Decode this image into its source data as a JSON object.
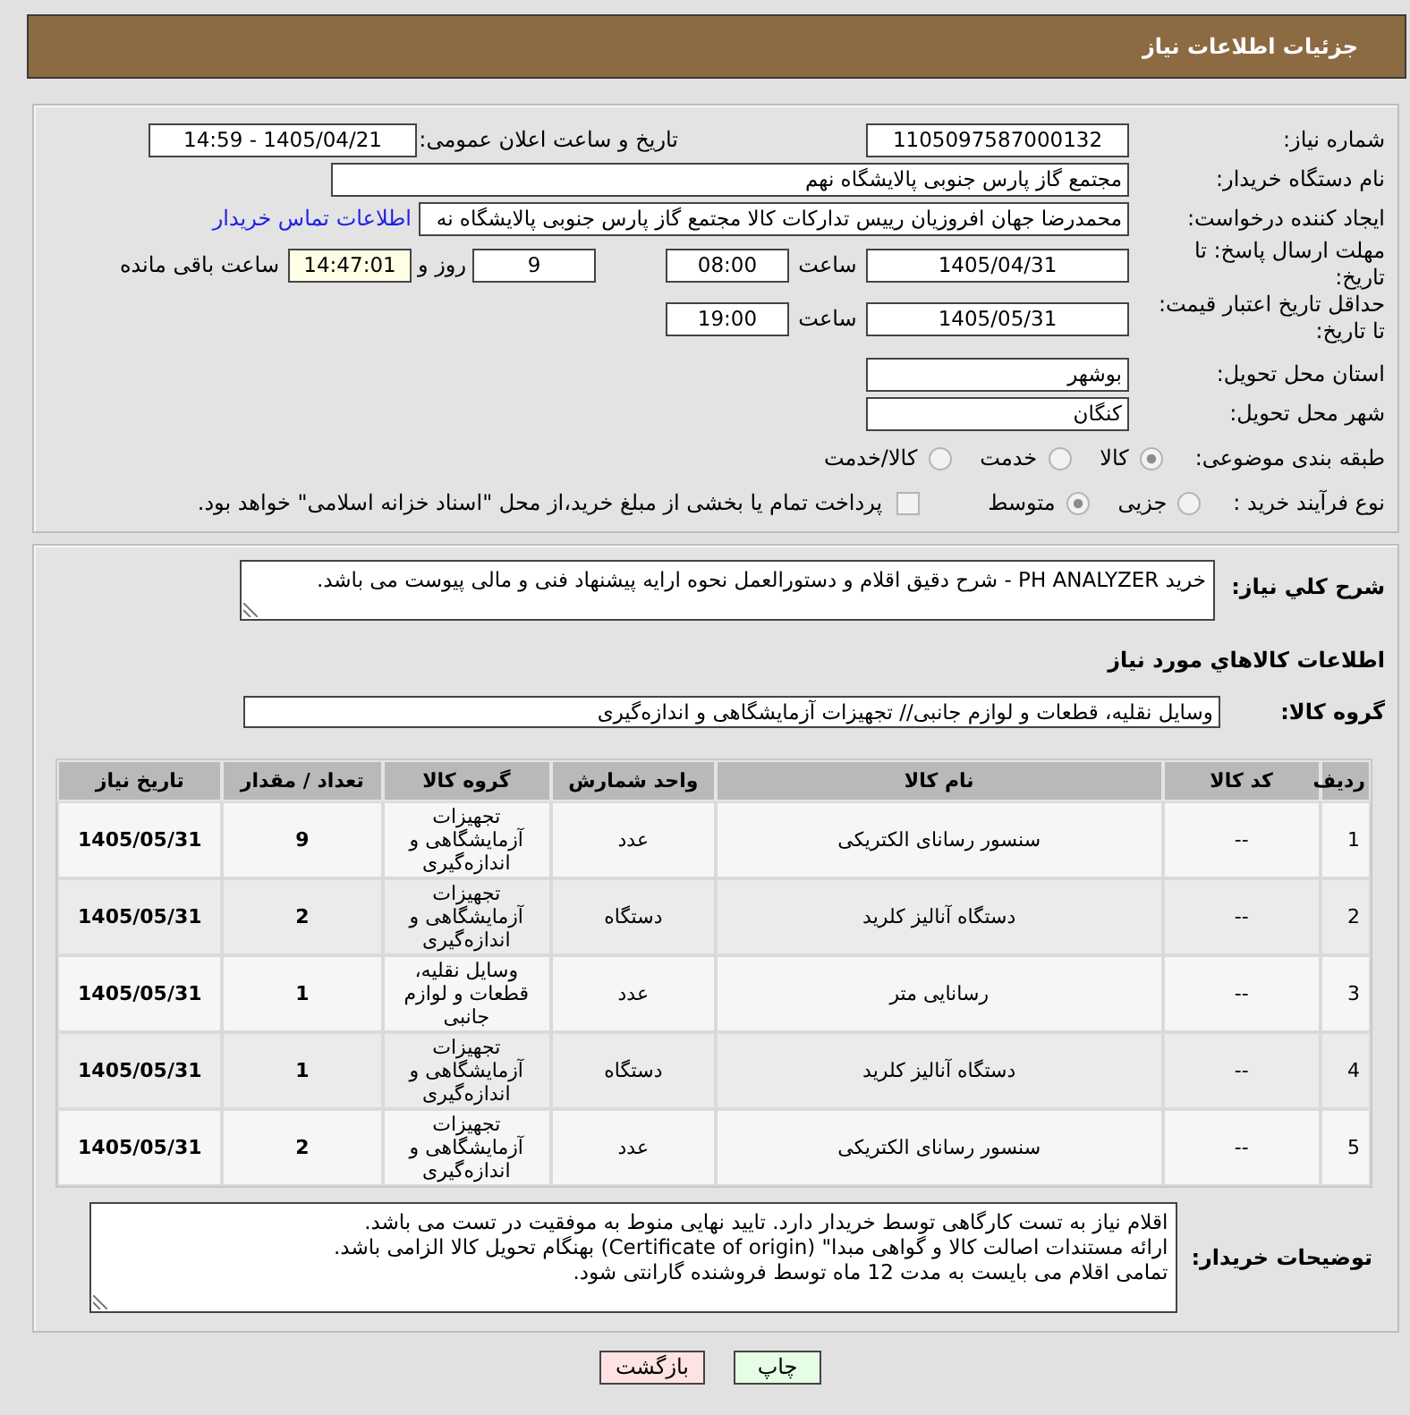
{
  "header": {
    "title": "جزئیات اطلاعات نیاز"
  },
  "form": {
    "need_number": {
      "label": "شماره نیاز:",
      "value": "1105097587000132"
    },
    "announce_date": {
      "label": "تاریخ و ساعت اعلان عمومی:",
      "value": "1405/04/21 - 14:59"
    },
    "buyer_org": {
      "label": "نام دستگاه خریدار:",
      "value": "مجتمع گاز پارس جنوبی  پالایشگاه نهم"
    },
    "requester": {
      "label": "ایجاد کننده درخواست:",
      "value": "محمدرضا جهان افروزیان رییس تدارکات کالا مجتمع گاز پارس جنوبی  پالایشگاه نه",
      "link": "اطلاعات تماس خریدار"
    },
    "reply_deadline": {
      "label": "مهلت ارسال پاسخ: تا تاریخ:",
      "date": "1405/04/31",
      "time_label": "ساعت",
      "time": "08:00",
      "days": "9",
      "days_label": "روز و",
      "remaining": "14:47:01",
      "remaining_label": "ساعت باقی مانده"
    },
    "price_validity": {
      "label": "حداقل تاریخ اعتبار قیمت: تا تاریخ:",
      "date": "1405/05/31",
      "time_label": "ساعت",
      "time": "19:00"
    },
    "province": {
      "label": "استان محل تحویل:",
      "value": "بوشهر"
    },
    "city": {
      "label": "شهر محل تحویل:",
      "value": "کنگان"
    },
    "category": {
      "label": "طبقه بندی موضوعی:",
      "options": [
        {
          "label": "کالا",
          "selected": true
        },
        {
          "label": "خدمت",
          "selected": false
        },
        {
          "label": "کالا/خدمت",
          "selected": false
        }
      ]
    },
    "purchase_process": {
      "label": "نوع فرآیند خرید :",
      "options": [
        {
          "label": "جزیی",
          "selected": false
        },
        {
          "label": "متوسط",
          "selected": true
        }
      ],
      "treasury": {
        "label": "پرداخت تمام یا بخشی از مبلغ خرید،از محل \"اسناد خزانه اسلامی\" خواهد بود.",
        "checked": false
      }
    }
  },
  "details": {
    "description": {
      "label": "شرح کلي نیاز:",
      "value": "خرید PH ANALYZER - شرح دقیق اقلام و دستورالعمل نحوه ارایه پیشنهاد فنی و مالی پیوست می باشد."
    },
    "items_title": "اطلاعات کالاهاي مورد نیاز",
    "group": {
      "label": "گروه کالا:",
      "value": "وسایل نقلیه، قطعات و لوازم جانبی// تجهیزات آزمایشگاهی و اندازه‌گیری"
    }
  },
  "table": {
    "columns": [
      {
        "label": "ردیف",
        "kind": "index"
      },
      {
        "label": "کد کالا",
        "kind": "code"
      },
      {
        "label": "نام کالا",
        "kind": "name"
      },
      {
        "label": "واحد شمارش",
        "kind": "unit"
      },
      {
        "label": "گروه کالا",
        "kind": "group"
      },
      {
        "label": "تعداد / مقدار",
        "kind": "qty"
      },
      {
        "label": "تاریخ نیاز",
        "kind": "date"
      }
    ],
    "rows": [
      [
        "1",
        "--",
        "سنسور رسانای الکتریکی",
        "عدد",
        "تجهیزات آزمایشگاهی و اندازه‌گیری",
        "9",
        "1405/05/31"
      ],
      [
        "2",
        "--",
        "دستگاه آنالیز کلرید",
        "دستگاه",
        "تجهیزات آزمایشگاهی و اندازه‌گیری",
        "2",
        "1405/05/31"
      ],
      [
        "3",
        "--",
        "رسانایی متر",
        "عدد",
        "وسایل نقلیه، قطعات و لوازم جانبی",
        "1",
        "1405/05/31"
      ],
      [
        "4",
        "--",
        "دستگاه آنالیز کلرید",
        "دستگاه",
        "تجهیزات آزمایشگاهی و اندازه‌گیری",
        "1",
        "1405/05/31"
      ],
      [
        "5",
        "--",
        "سنسور رسانای الکتریکی",
        "عدد",
        "تجهیزات آزمایشگاهی و اندازه‌گیری",
        "2",
        "1405/05/31"
      ]
    ]
  },
  "notes": {
    "label": "توضیحات خریدار:",
    "value": "اقلام نیاز به تست کارگاهی توسط خریدار دارد. تایید نهایی منوط به موفقیت در تست می باشد.\nارائه مستندات اصالت کالا و گواهی مبدا\" (Certificate of origin) بهنگام تحویل کالا الزامی باشد.\nتمامی اقلام می بایست به مدت 12 ماه توسط فروشنده گارانتی شود."
  },
  "buttons": [
    {
      "label": "چاپ",
      "kind": "print"
    },
    {
      "label": "بازگشت",
      "kind": "back"
    }
  ]
}
